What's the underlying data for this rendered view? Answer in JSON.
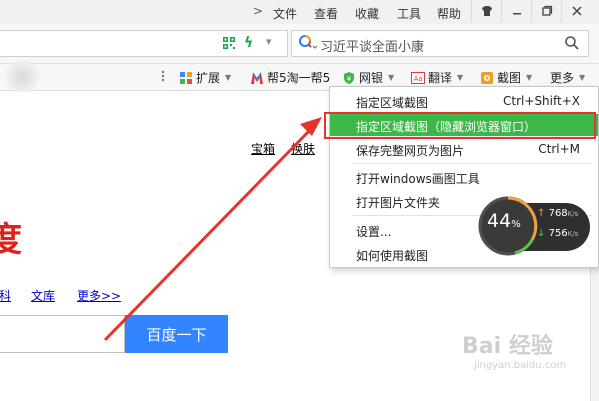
{
  "menubar": {
    "items": [
      "文件",
      "查看",
      "收藏",
      "工具",
      "帮助"
    ]
  },
  "address": {
    "search_text": "习近平谈全面小康"
  },
  "toolbar": {
    "items": [
      {
        "label": "扩展",
        "icon": "extensions-icon"
      },
      {
        "label": "帮5淘一帮5",
        "icon": "m-logo-icon"
      },
      {
        "label": "网银",
        "icon": "shield-yen-icon"
      },
      {
        "label": "翻译",
        "icon": "translate-icon"
      },
      {
        "label": "截图",
        "icon": "screenshot-icon"
      },
      {
        "label": "更多",
        "icon": "more-icon"
      }
    ]
  },
  "page": {
    "top_links": [
      "宝箱",
      "换肤"
    ],
    "logo_partial": "度",
    "nav_links": [
      "科",
      "文库",
      "更多>>"
    ],
    "search_button": "百度一下"
  },
  "menu": {
    "items": [
      {
        "label": "指定区域截图",
        "shortcut": "Ctrl+Shift+X"
      },
      {
        "label": "指定区域截图（隐藏浏览器窗口）",
        "shortcut": ""
      },
      {
        "label": "保存完整网页为图片",
        "shortcut": "Ctrl+M"
      },
      {
        "label": "打开windows画图工具",
        "shortcut": ""
      },
      {
        "label": "打开图片文件夹",
        "shortcut": ""
      },
      {
        "label": "设置...",
        "shortcut": ""
      },
      {
        "label": "如何使用截图",
        "shortcut": ""
      }
    ],
    "highlight_color": "#3cb849",
    "annotation_color": "#e8332a"
  },
  "speed": {
    "percent": "44",
    "percent_sign": "%",
    "upload": "768",
    "download": "756",
    "unit": "K/s"
  },
  "watermark": {
    "brand": "Bai  经验",
    "url": "jingyan.baidu.com"
  }
}
